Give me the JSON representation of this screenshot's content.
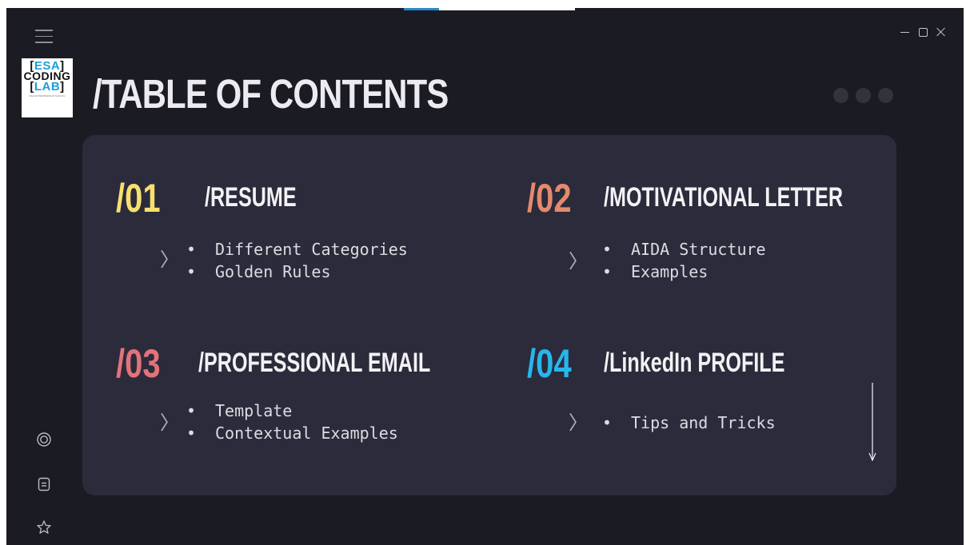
{
  "window": {
    "title": "/TABLE OF CONTENTS",
    "controls": [
      "minimize",
      "maximize",
      "close"
    ]
  },
  "logo": {
    "line1": "ESA",
    "line2": "CODING",
    "line3": "LAB",
    "tagline": "ESA ENTREPRENEUR SCHOOL"
  },
  "sidebar": {
    "top_icon": "menu-icon",
    "bottom_icons": [
      "target-icon",
      "document-icon",
      "star-icon"
    ]
  },
  "sections": [
    {
      "number": "/01",
      "heading": "/RESUME",
      "color": "#f8df6f",
      "items": [
        "Different Categories",
        "Golden Rules"
      ]
    },
    {
      "number": "/02",
      "heading": "/MOTIVATIONAL LETTER",
      "color": "#e48a6c",
      "items": [
        "AIDA Structure",
        "Examples"
      ]
    },
    {
      "number": "/03",
      "heading": "/PROFESSIONAL EMAIL",
      "color": "#e3727a",
      "items": [
        "Template",
        "Contextual Examples"
      ]
    },
    {
      "number": "/04",
      "heading": "/LinkedIn PROFILE",
      "color": "#28b6ec",
      "items": [
        "Tips and Tricks"
      ]
    }
  ],
  "colors": {
    "background": "#1b1b23",
    "card": "#2b2b3b",
    "text": "#f2f2f5"
  }
}
